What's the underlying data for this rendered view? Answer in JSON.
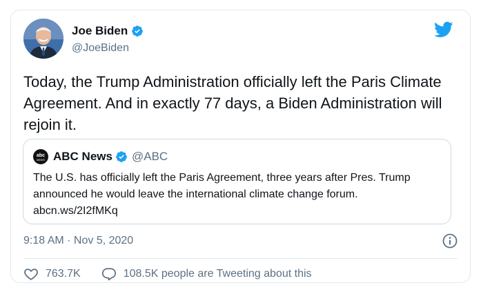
{
  "tweet": {
    "author": {
      "display_name": "Joe Biden",
      "handle": "@JoeBiden",
      "verified": true
    },
    "text": "Today, the Trump Administration officially left the Paris Climate Agreement. And in exactly 77 days, a Biden Administration will rejoin it.",
    "quoted": {
      "logo_label": "abc NEWS",
      "display_name": "ABC News",
      "handle": "@ABC",
      "verified": true,
      "text": "The U.S. has officially left the Paris Agreement, three years after Pres. Trump announced he would leave the international climate change forum.",
      "link": "abcn.ws/2I2fMKq"
    },
    "timestamp": "9:18 AM · Nov 5, 2020",
    "likes": "763.7K",
    "replies_text": "108.5K people are Tweeting about this"
  },
  "colors": {
    "accent": "#1da1f2",
    "text": "#0f1419",
    "secondary": "#5b7083",
    "border": "#e1e8ed"
  },
  "icons": {
    "brand": "twitter-bird-icon",
    "verified": "verified-badge-icon",
    "info": "info-icon",
    "like": "heart-icon",
    "reply": "speech-bubble-icon"
  }
}
